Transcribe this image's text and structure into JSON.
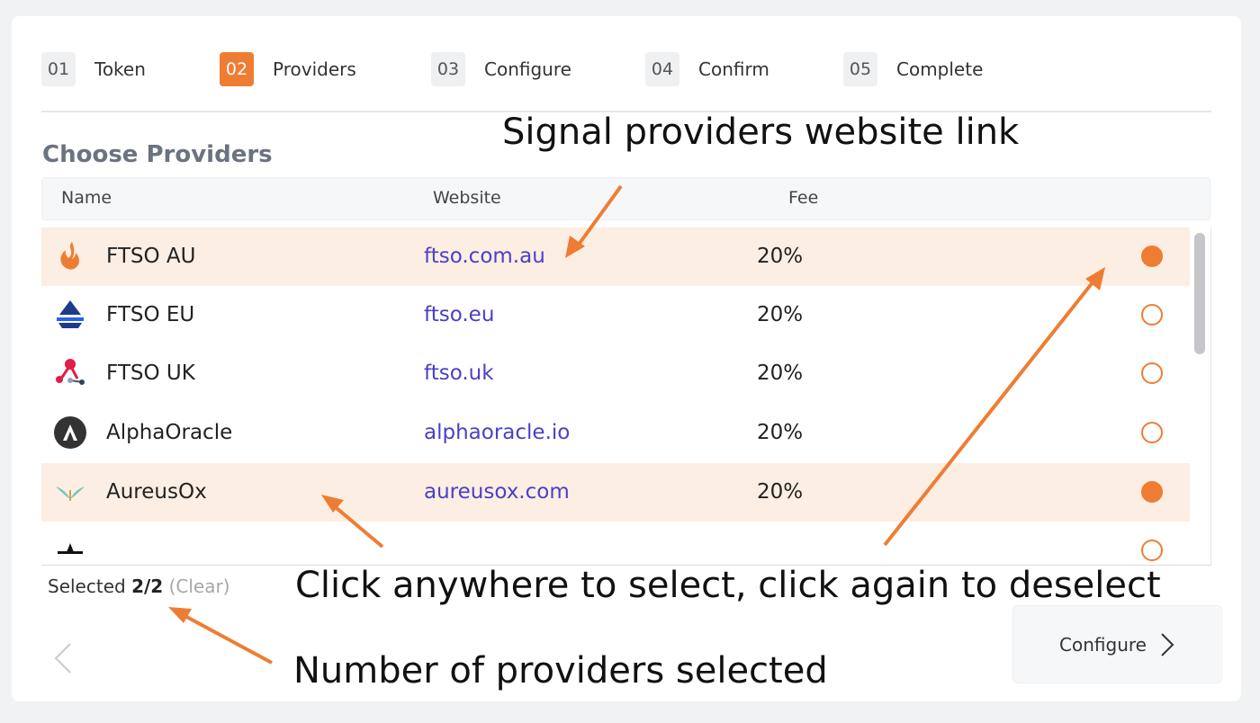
{
  "steps": [
    {
      "num": "01",
      "label": "Token",
      "active": false
    },
    {
      "num": "02",
      "label": "Providers",
      "active": true
    },
    {
      "num": "03",
      "label": "Configure",
      "active": false
    },
    {
      "num": "04",
      "label": "Confirm",
      "active": false
    },
    {
      "num": "05",
      "label": "Complete",
      "active": false
    }
  ],
  "section_title": "Choose Providers",
  "table": {
    "headers": {
      "name": "Name",
      "website": "Website",
      "fee": "Fee"
    },
    "rows": [
      {
        "name": "FTSO AU",
        "website": "ftso.com.au",
        "fee": "20%",
        "selected": true,
        "icon": "flame-icon"
      },
      {
        "name": "FTSO EU",
        "website": "ftso.eu",
        "fee": "20%",
        "selected": false,
        "icon": "sailboat-icon"
      },
      {
        "name": "FTSO UK",
        "website": "ftso.uk",
        "fee": "20%",
        "selected": false,
        "icon": "network-nodes-icon"
      },
      {
        "name": "AlphaOracle",
        "website": "alphaoracle.io",
        "fee": "20%",
        "selected": false,
        "icon": "alpha-logo-icon"
      },
      {
        "name": "AureusOx",
        "website": "aureusox.com",
        "fee": "20%",
        "selected": true,
        "icon": "wings-icon"
      }
    ]
  },
  "selection": {
    "prefix": "Selected",
    "count": "2/2",
    "clear": "(Clear)"
  },
  "buttons": {
    "configure": "Configure"
  },
  "annotations": {
    "website_link": "Signal providers website link",
    "click_select": "Click anywhere to select, click again to deselect",
    "number_selected": "Number of providers selected"
  },
  "colors": {
    "accent": "#ee7d33",
    "link": "#4a40c8",
    "selected_row": "#fdeee3"
  }
}
